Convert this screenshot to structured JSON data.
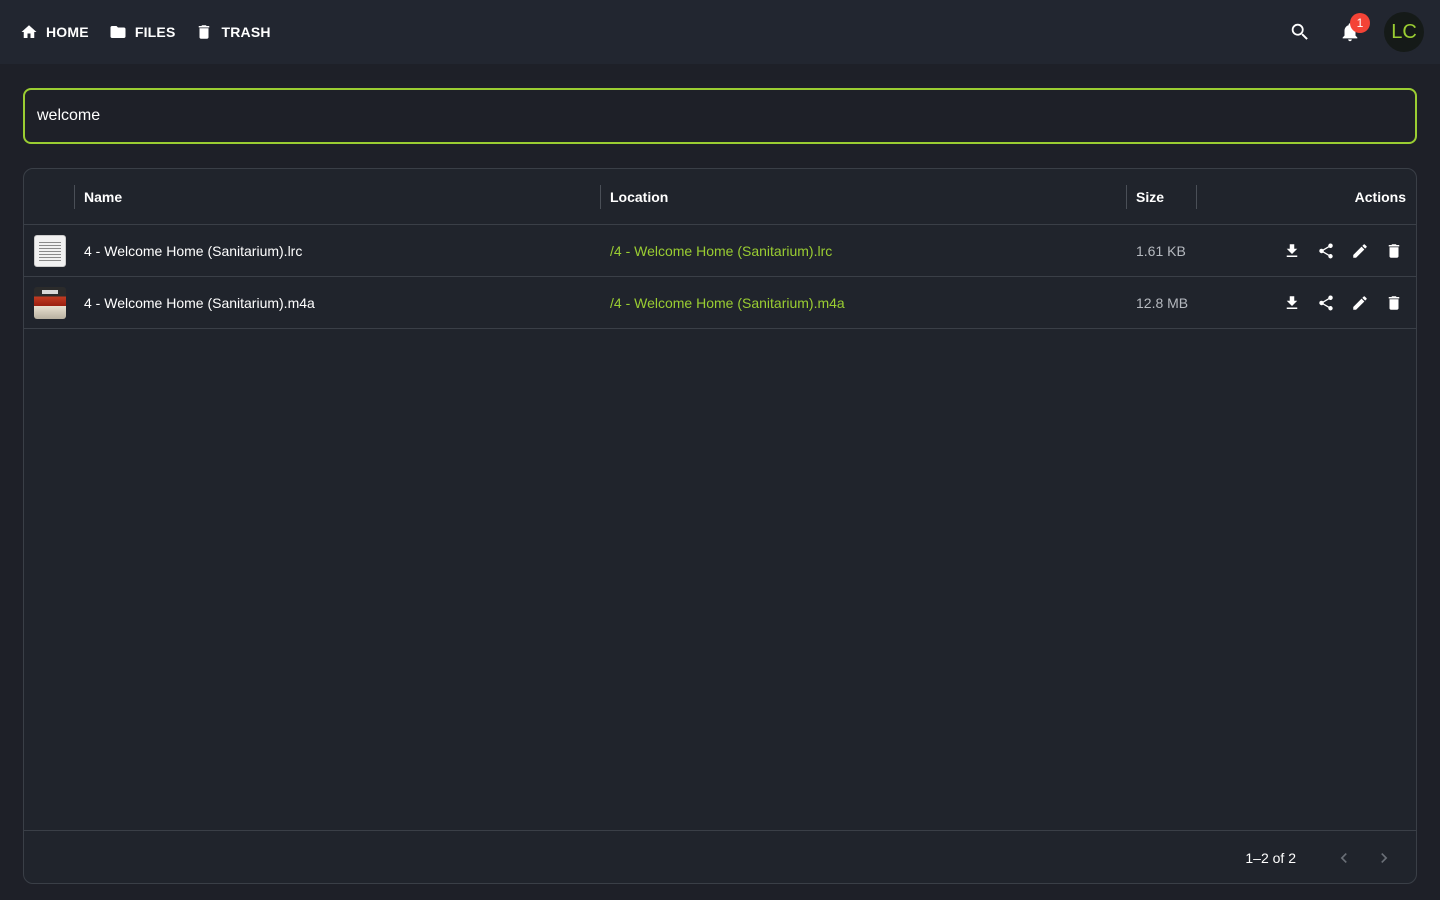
{
  "nav": {
    "items": [
      {
        "label": "HOME",
        "icon": "home-icon"
      },
      {
        "label": "FILES",
        "icon": "folder-icon"
      },
      {
        "label": "TRASH",
        "icon": "trash-icon"
      }
    ]
  },
  "header": {
    "notifications_count": "1",
    "avatar_initials": "LC"
  },
  "search": {
    "value": "welcome",
    "placeholder": ""
  },
  "table": {
    "columns": {
      "name": "Name",
      "location": "Location",
      "size": "Size",
      "actions": "Actions"
    },
    "rows": [
      {
        "thumbnail": "lyrics-file-thumbnail",
        "name": "4 - Welcome Home (Sanitarium).lrc",
        "location": "/4 - Welcome Home (Sanitarium).lrc",
        "size": "1.61 KB"
      },
      {
        "thumbnail": "album-art-thumbnail",
        "name": "4 - Welcome Home (Sanitarium).m4a",
        "location": "/4 - Welcome Home (Sanitarium).m4a",
        "size": "12.8 MB"
      }
    ],
    "row_actions": [
      "download-icon",
      "share-icon",
      "edit-icon",
      "delete-icon"
    ],
    "pagination": "1–2 of 2"
  },
  "colors": {
    "accent": "#9acd32",
    "background": "#1e2028",
    "topbar": "#222630",
    "badge": "#f44336"
  }
}
